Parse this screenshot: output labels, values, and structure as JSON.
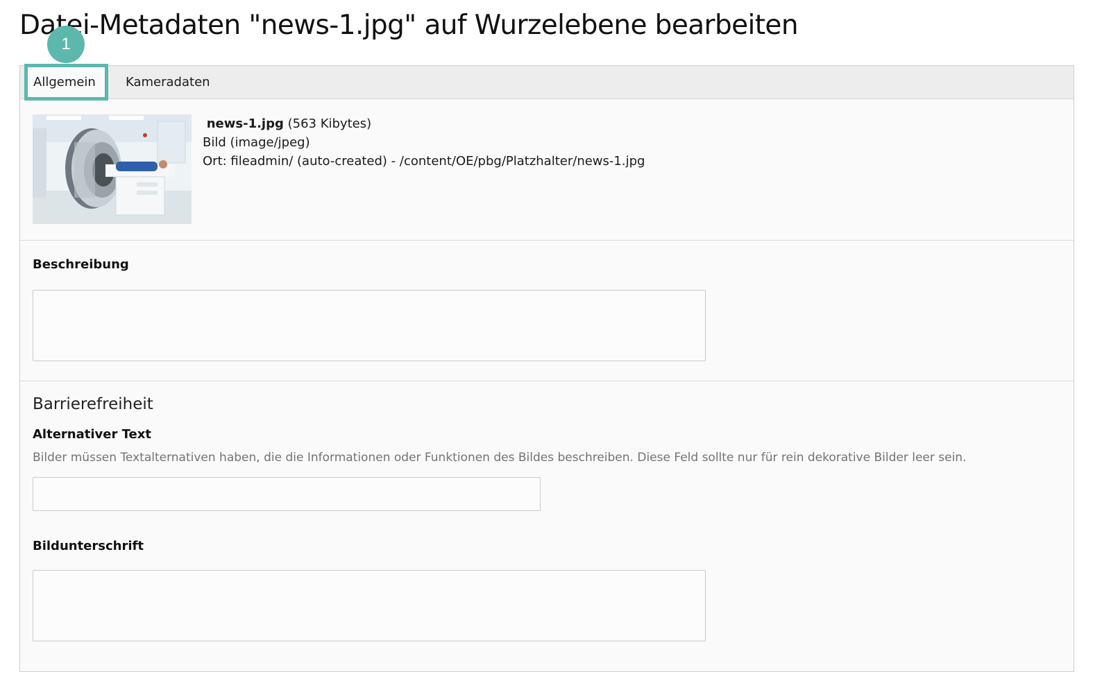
{
  "header": {
    "title": "Datei-Metadaten \"news-1.jpg\" auf Wurzelebene bearbeiten"
  },
  "annotation": {
    "step_number": "1",
    "color": "#5cb8ad"
  },
  "tabs": [
    {
      "label": "Allgemein",
      "active": true
    },
    {
      "label": "Kameradaten",
      "active": false
    }
  ],
  "file": {
    "name": "news-1.jpg",
    "size": "(563 Kibytes)",
    "type": "Bild (image/jpeg)",
    "location": "Ort: fileadmin/ (auto-created) - /content/OE/pbg/Platzhalter/news-1.jpg"
  },
  "fields": {
    "description": {
      "label": "Beschreibung",
      "value": ""
    },
    "accessibility_group": "Barrierefreiheit",
    "alt_text": {
      "label": "Alternativer Text",
      "help": "Bilder müssen Textalternativen haben, die die Informationen oder Funktionen des Bildes beschreiben. Diese Feld sollte nur für rein dekorative Bilder leer sein.",
      "value": ""
    },
    "caption": {
      "label": "Bildunterschrift",
      "value": ""
    }
  }
}
